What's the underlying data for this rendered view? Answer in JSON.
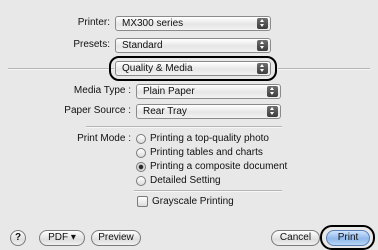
{
  "printer": {
    "label": "Printer:",
    "value": "MX300 series"
  },
  "presets": {
    "label": "Presets:",
    "value": "Standard"
  },
  "panel": {
    "value": "Quality & Media"
  },
  "media_type": {
    "label": "Media Type :",
    "value": "Plain Paper"
  },
  "paper_source": {
    "label": "Paper Source :",
    "value": "Rear Tray"
  },
  "print_mode": {
    "label": "Print Mode :",
    "options": [
      "Printing a top-quality photo",
      "Printing tables and charts",
      "Printing a composite document",
      "Detailed Setting"
    ],
    "selected": 2
  },
  "grayscale": {
    "label": "Grayscale Printing",
    "checked": false
  },
  "footer": {
    "help": "?",
    "pdf": "PDF ▾",
    "preview": "Preview",
    "cancel": "Cancel",
    "print": "Print"
  }
}
